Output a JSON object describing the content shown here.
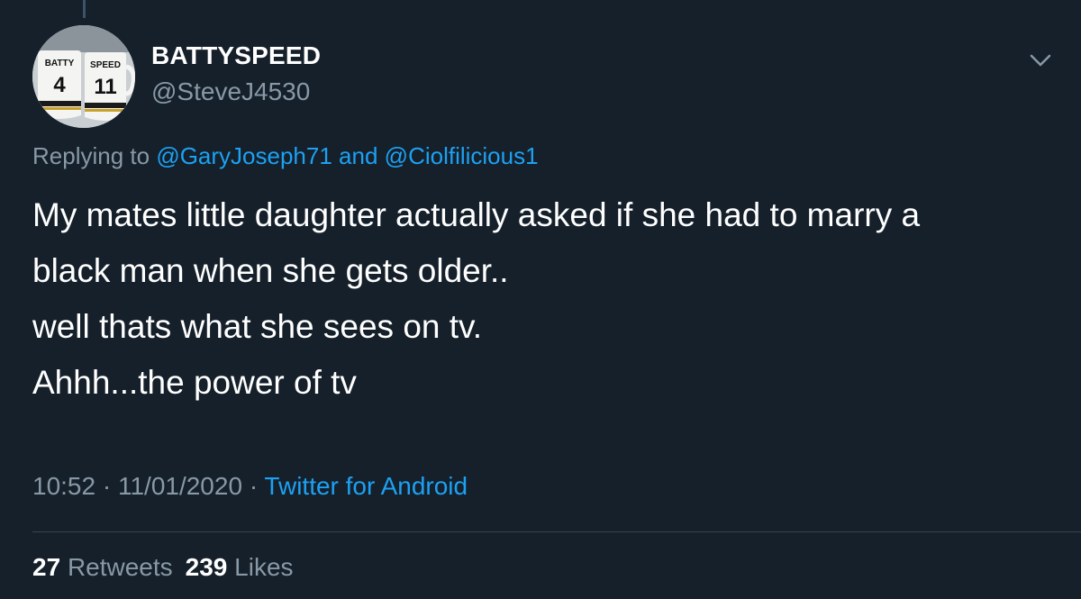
{
  "tweet": {
    "author": {
      "display_name": "BATTYSPEED",
      "handle": "@SteveJ4530",
      "avatar_mugs": [
        {
          "name": "BATTY",
          "number": "4"
        },
        {
          "name": "SPEED",
          "number": "11"
        }
      ]
    },
    "reply": {
      "prefix": "Replying to",
      "mention_1": "@GaryJoseph71",
      "conjunction": "and",
      "mention_2": "@Ciolfilicious1"
    },
    "text_lines": [
      "My mates little daughter actually asked if she had to marry a",
      "black man when she gets older..",
      "well thats what she sees on tv.",
      "Ahhh...the power of tv"
    ],
    "time": "10:52",
    "date": "11/01/2020",
    "separator": "·",
    "source": "Twitter for Android",
    "stats": {
      "retweets_count": "27",
      "retweets_label": "Retweets",
      "likes_count": "239",
      "likes_label": "Likes"
    }
  },
  "icons": {
    "more_menu": "chevron-down-icon"
  },
  "colors": {
    "background": "#15202b",
    "primary_text": "#ffffff",
    "secondary_text": "#8899a6",
    "link": "#1da1f2",
    "divider": "#38444d"
  }
}
